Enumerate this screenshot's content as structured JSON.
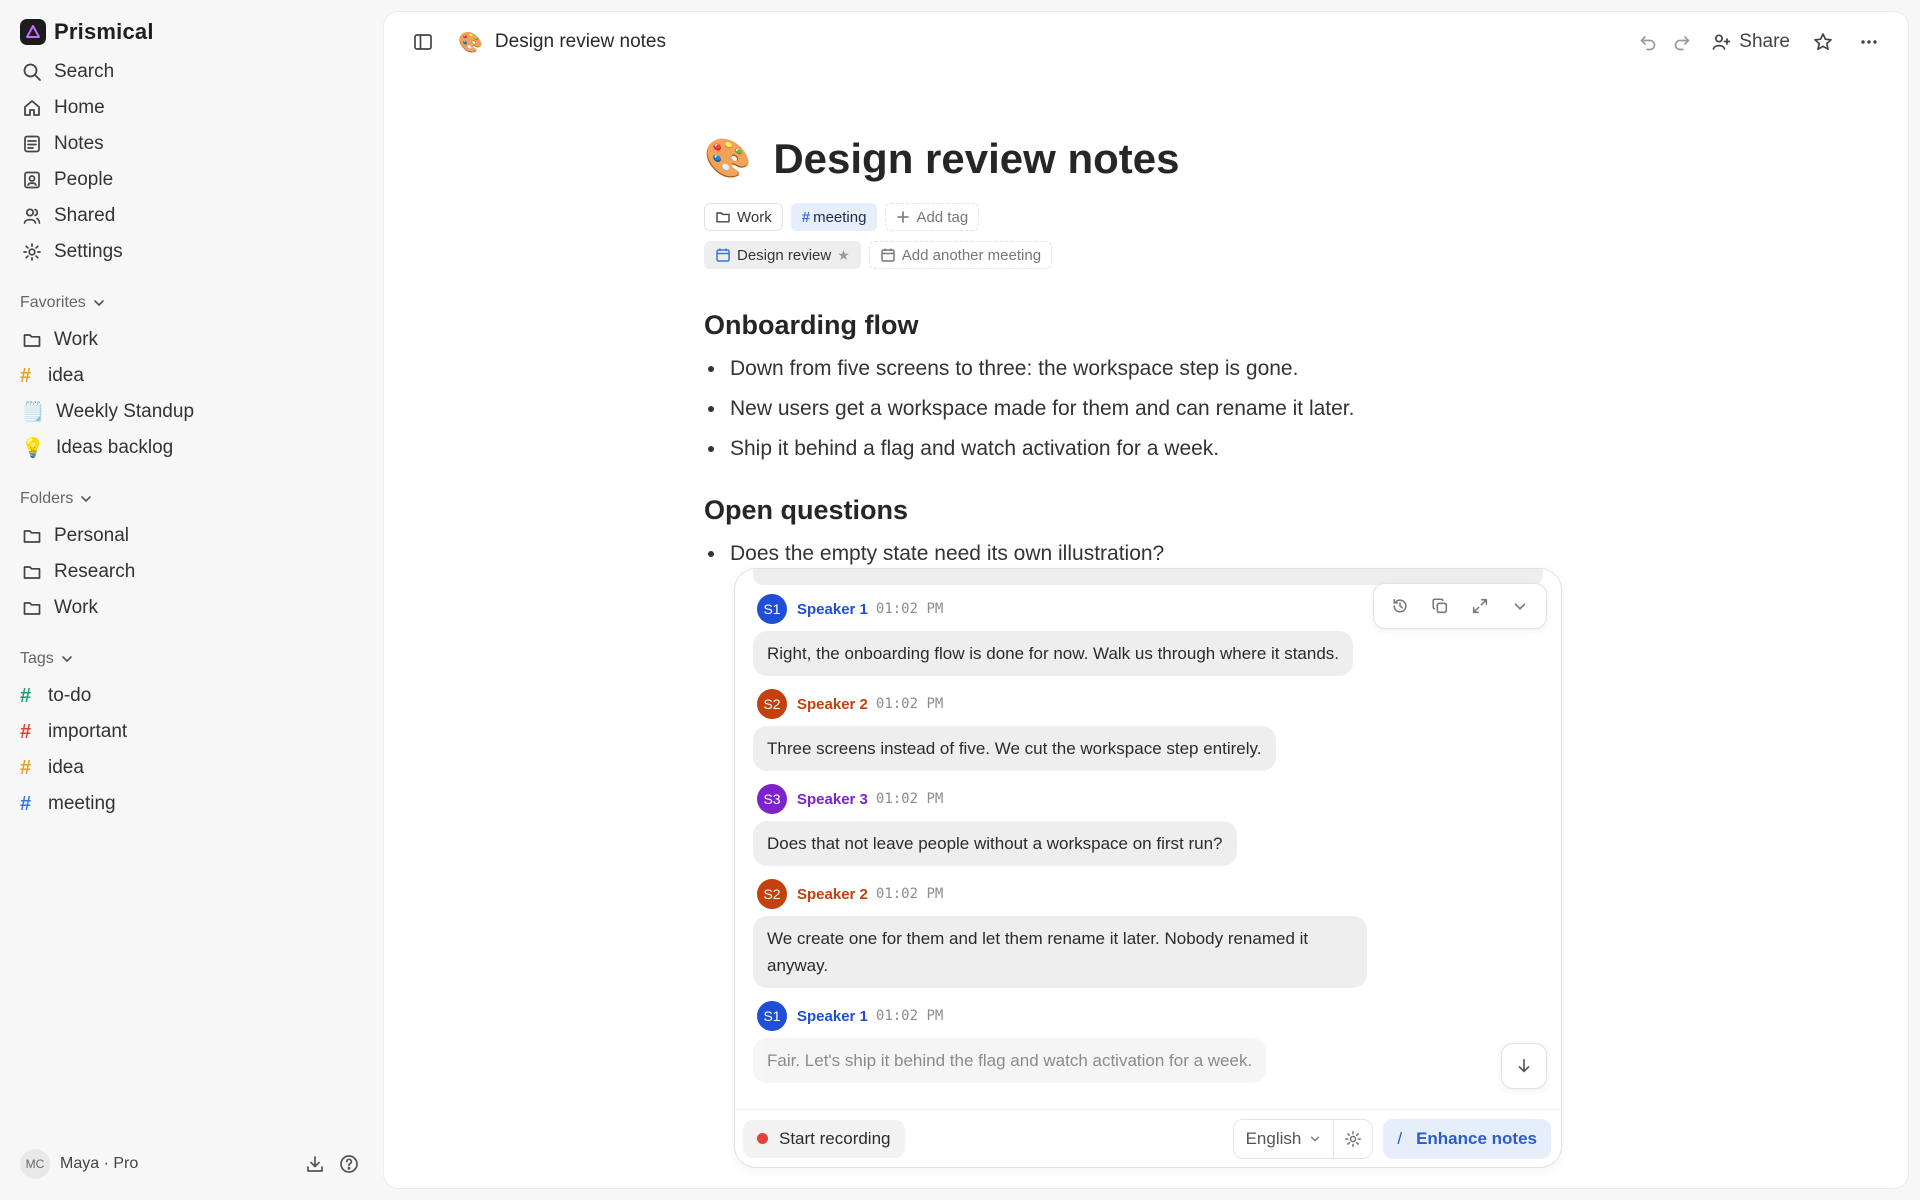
{
  "app": {
    "name": "Prismical"
  },
  "sidebar": {
    "nav": [
      {
        "label": "Search"
      },
      {
        "label": "Home"
      },
      {
        "label": "Notes"
      },
      {
        "label": "People"
      },
      {
        "label": "Shared"
      },
      {
        "label": "Settings"
      }
    ],
    "favorites": {
      "title": "Favorites",
      "items": [
        {
          "label": "Work"
        },
        {
          "label": "idea",
          "color": "#e8a317"
        },
        {
          "label": "Weekly Standup",
          "emoji": "🗒️"
        },
        {
          "label": "Ideas backlog",
          "emoji": "💡"
        }
      ]
    },
    "folders": {
      "title": "Folders",
      "items": [
        {
          "label": "Personal"
        },
        {
          "label": "Research"
        },
        {
          "label": "Work"
        }
      ]
    },
    "tags": {
      "title": "Tags",
      "items": [
        {
          "label": "to-do",
          "color": "#1aa36a"
        },
        {
          "label": "important",
          "color": "#e0423a"
        },
        {
          "label": "idea",
          "color": "#e8a317"
        },
        {
          "label": "meeting",
          "color": "#3b73e8"
        }
      ]
    },
    "user": {
      "initials": "MC",
      "label": "Maya · Pro"
    }
  },
  "topbar": {
    "emoji": "🎨",
    "title": "Design review notes",
    "share_label": "Share"
  },
  "doc": {
    "emoji": "🎨",
    "title": "Design review notes",
    "folder_chip": "Work",
    "tag_chip": "meeting",
    "add_tag": "Add tag",
    "meeting_chip": "Design review",
    "add_meeting": "Add another meeting",
    "sections": [
      {
        "heading": "Onboarding flow",
        "bullets": [
          "Down from five screens to three: the workspace step is gone.",
          "New users get a workspace made for them and can rename it later.",
          "Ship it behind a flag and watch activation for a week."
        ]
      },
      {
        "heading": "Open questions",
        "bullets": [
          "Does the empty state need its own illustration?"
        ]
      }
    ]
  },
  "transcript": {
    "messages": [
      {
        "initials": "S1",
        "speaker": "Speaker 1",
        "time": "01:02 PM",
        "color": "#1f4fd6",
        "text": "Right, the onboarding flow is done for now. Walk us through where it stands."
      },
      {
        "initials": "S2",
        "speaker": "Speaker 2",
        "time": "01:02 PM",
        "color": "#c2410c",
        "text": "Three screens instead of five. We cut the workspace step entirely."
      },
      {
        "initials": "S3",
        "speaker": "Speaker 3",
        "time": "01:02 PM",
        "color": "#7e22ce",
        "text": "Does that not leave people without a workspace on first run?"
      },
      {
        "initials": "S2",
        "speaker": "Speaker 2",
        "time": "01:02 PM",
        "color": "#c2410c",
        "text": "We create one for them and let them rename it later. Nobody renamed it anyway."
      },
      {
        "initials": "S1",
        "speaker": "Speaker 1",
        "time": "01:02 PM",
        "color": "#1f4fd6",
        "text": "Fair. Let's ship it behind the flag and watch activation for a week."
      }
    ],
    "record_label": "Start recording",
    "language": "English",
    "enhance_label": "Enhance notes",
    "enhance_shortcut": "/"
  }
}
